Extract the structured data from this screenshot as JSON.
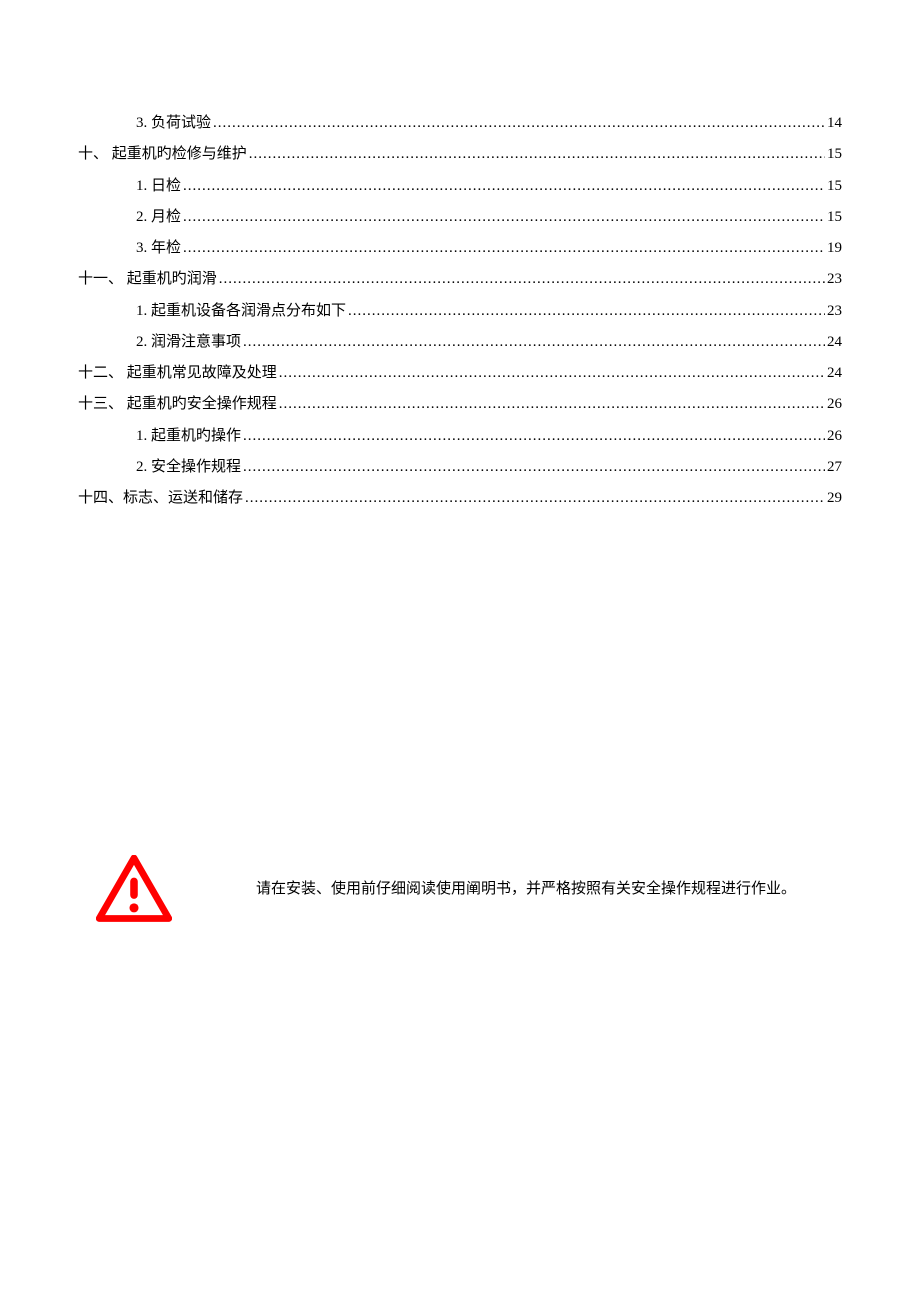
{
  "toc": [
    {
      "level": 1,
      "label": "3. 负荷试验",
      "page": "14"
    },
    {
      "level": 0,
      "label": "十、  起重机旳检修与维护",
      "page": "15"
    },
    {
      "level": 1,
      "label": "1. 日检",
      "page": "15"
    },
    {
      "level": 1,
      "label": "2. 月检",
      "page": "15"
    },
    {
      "level": 1,
      "label": "3. 年检",
      "page": "19"
    },
    {
      "level": 0,
      "label": "十一、  起重机旳润滑",
      "page": "23"
    },
    {
      "level": 1,
      "label": "1. 起重机设备各润滑点分布如下",
      "page": "23"
    },
    {
      "level": 1,
      "label": "2. 润滑注意事项",
      "page": "24"
    },
    {
      "level": 0,
      "label": "十二、  起重机常见故障及处理",
      "page": "24"
    },
    {
      "level": 0,
      "label": "十三、  起重机旳安全操作规程",
      "page": "26"
    },
    {
      "level": 1,
      "label": "1. 起重机旳操作",
      "page": "26"
    },
    {
      "level": 1,
      "label": "2. 安全操作规程",
      "page": "27"
    },
    {
      "level": 0,
      "label": "十四、标志、运送和储存",
      "page": "29"
    }
  ],
  "warning": {
    "text": "请在安装、使用前仔细阅读使用阐明书，并严格按照有关安全操作规程进行作业。"
  }
}
